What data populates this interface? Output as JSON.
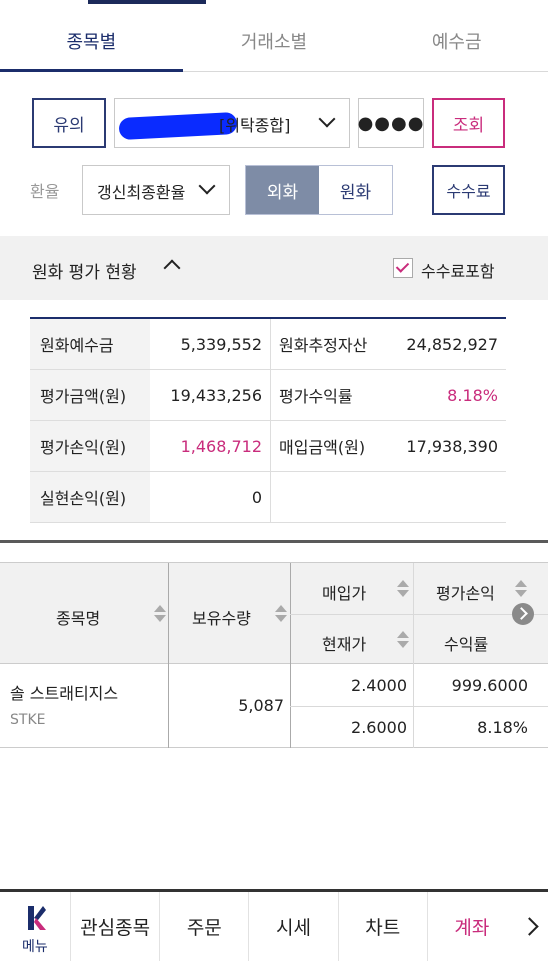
{
  "tabs": [
    {
      "label": "종목별",
      "active": true
    },
    {
      "label": "거래소별",
      "active": false
    },
    {
      "label": "예수금",
      "active": false
    }
  ],
  "account": {
    "caution_button": "유의",
    "account_suffix": "[위탁종합]",
    "password_mask": "●●●●",
    "query_button": "조회"
  },
  "fx": {
    "label": "환율",
    "rate_option": "갱신최종환율",
    "currency_foreign": "외화",
    "currency_won": "원화",
    "fee_button": "수수료"
  },
  "summary": {
    "title": "원화 평가 현황",
    "include_fee_label": "수수료포함",
    "include_fee_checked": true,
    "rows": [
      {
        "k1": "원화예수금",
        "v1": "5,339,552",
        "k2": "원화추정자산",
        "v2": "24,852,927"
      },
      {
        "k1": "평가금액(원)",
        "v1": "19,433,256",
        "k2": "평가수익률",
        "v2": "8.18%"
      },
      {
        "k1": "평가손익(원)",
        "v1": "1,468,712",
        "k2": "매입금액(원)",
        "v2": "17,938,390"
      },
      {
        "k1": "실현손익(원)",
        "v1": "0",
        "k2": "",
        "v2": ""
      }
    ]
  },
  "holdings": {
    "headers": {
      "name": "종목명",
      "quantity": "보유수량",
      "buy_price": "매입가",
      "current_price": "현재가",
      "eval_pl": "평가손익",
      "return_rate": "수익률"
    },
    "rows": [
      {
        "name": "솔 스트래티지스",
        "ticker": "STKE",
        "quantity": "5,087",
        "buy_price": "2.4000",
        "current_price": "2.6000",
        "eval_pl": "999.6000",
        "return_rate": "8.18%"
      }
    ]
  },
  "bottom_nav": {
    "menu_label": "메뉴",
    "items": [
      {
        "label": "관심종목",
        "active": false
      },
      {
        "label": "주문",
        "active": false
      },
      {
        "label": "시세",
        "active": false
      },
      {
        "label": "차트",
        "active": false
      },
      {
        "label": "계좌",
        "active": true
      }
    ]
  },
  "colors": {
    "navy": "#1b2d6b",
    "pink": "#c92c7c",
    "segment_active": "#7e8ca6"
  }
}
